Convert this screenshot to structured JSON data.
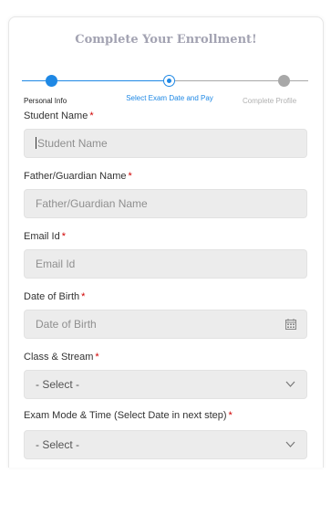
{
  "form": {
    "title": "Complete Your Enrollment!"
  },
  "stepper": {
    "steps": [
      {
        "label": "Personal Info",
        "state": "completed"
      },
      {
        "label": "Select Exam Date and Pay",
        "state": "active"
      },
      {
        "label": "Complete Profile",
        "state": "pending"
      }
    ],
    "colors": {
      "active": "#1e88e5",
      "pending": "#a8a8a8"
    }
  },
  "fields": {
    "student_name": {
      "label": "Student Name",
      "placeholder": "Student Name",
      "required_mark": "*"
    },
    "guardian_name": {
      "label": "Father/Guardian Name",
      "placeholder": "Father/Guardian Name",
      "required_mark": "*"
    },
    "email": {
      "label": "Email Id",
      "placeholder": "Email Id",
      "required_mark": "*"
    },
    "dob": {
      "label": "Date of Birth",
      "placeholder": "Date of Birth",
      "required_mark": "*",
      "icon": "calendar-icon"
    },
    "class_stream": {
      "label": "Class & Stream",
      "value": "- Select -",
      "required_mark": "*",
      "icon": "chevron-down-icon"
    },
    "exam_mode": {
      "label": "Exam Mode & Time (Select Date in next step)",
      "value": "- Select -",
      "required_mark": "*",
      "icon": "chevron-down-icon"
    }
  }
}
